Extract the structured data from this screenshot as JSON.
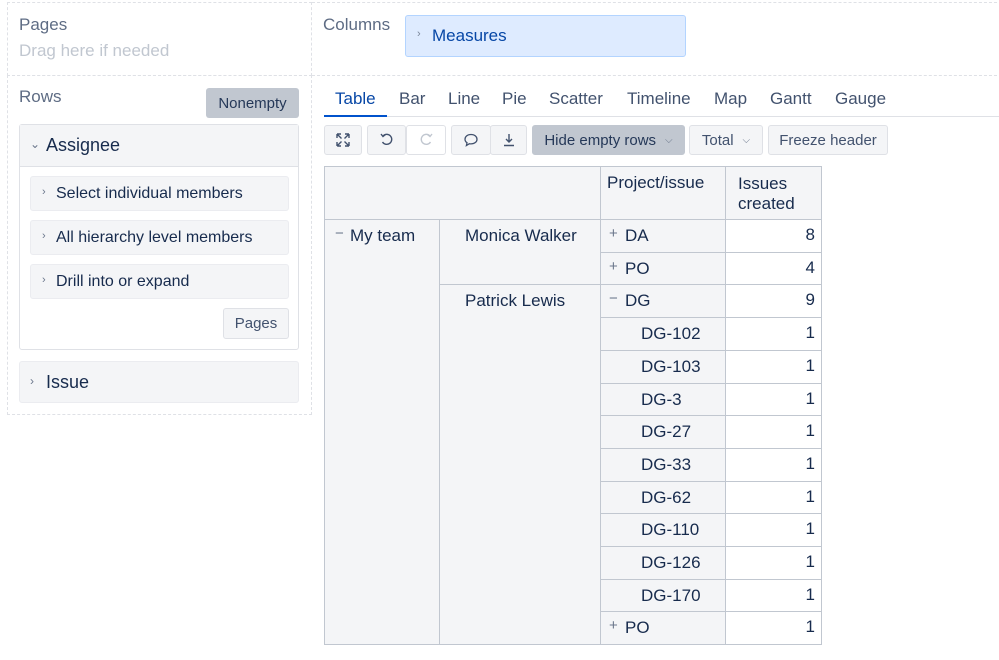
{
  "pages": {
    "title": "Pages",
    "hint": "Drag here if needed"
  },
  "columns": {
    "title": "Columns",
    "chip_label": "Measures"
  },
  "rows": {
    "title": "Rows",
    "nonempty_label": "Nonempty",
    "assignee": {
      "label": "Assignee",
      "options": [
        "Select individual members",
        "All hierarchy level members",
        "Drill into or expand"
      ],
      "pages_button": "Pages"
    },
    "issue_label": "Issue"
  },
  "tabs": [
    "Table",
    "Bar",
    "Line",
    "Pie",
    "Scatter",
    "Timeline",
    "Map",
    "Gantt",
    "Gauge"
  ],
  "active_tab": "Table",
  "toolbar": {
    "icons": [
      "expand-icon",
      "undo-icon",
      "redo-icon",
      "comment-icon",
      "download-icon"
    ],
    "hide_empty_rows": "Hide empty rows",
    "total": "Total",
    "freeze_header": "Freeze header"
  },
  "table": {
    "headers": {
      "project_issue": "Project/issue",
      "issues_created": "Issues created"
    },
    "team": {
      "label": "My team",
      "toggle": "−"
    },
    "assignees": [
      {
        "name": "Monica Walker"
      },
      {
        "name": "Patrick Lewis"
      }
    ],
    "rows": [
      {
        "toggle": "+",
        "label": "DA",
        "value": "8"
      },
      {
        "toggle": "+",
        "label": "PO",
        "value": "4"
      },
      {
        "toggle": "−",
        "label": "DG",
        "value": "9"
      },
      {
        "toggle": "",
        "label": "DG-102",
        "value": "1"
      },
      {
        "toggle": "",
        "label": "DG-103",
        "value": "1"
      },
      {
        "toggle": "",
        "label": "DG-3",
        "value": "1"
      },
      {
        "toggle": "",
        "label": "DG-27",
        "value": "1"
      },
      {
        "toggle": "",
        "label": "DG-33",
        "value": "1"
      },
      {
        "toggle": "",
        "label": "DG-62",
        "value": "1"
      },
      {
        "toggle": "",
        "label": "DG-110",
        "value": "1"
      },
      {
        "toggle": "",
        "label": "DG-126",
        "value": "1"
      },
      {
        "toggle": "",
        "label": "DG-170",
        "value": "1"
      },
      {
        "toggle": "+",
        "label": "PO",
        "value": "1"
      }
    ]
  },
  "colors": {
    "accent": "#0052cc",
    "chip_bg": "#deebff",
    "panel_bg": "#f4f5f7",
    "border": "#c1c7d0"
  }
}
